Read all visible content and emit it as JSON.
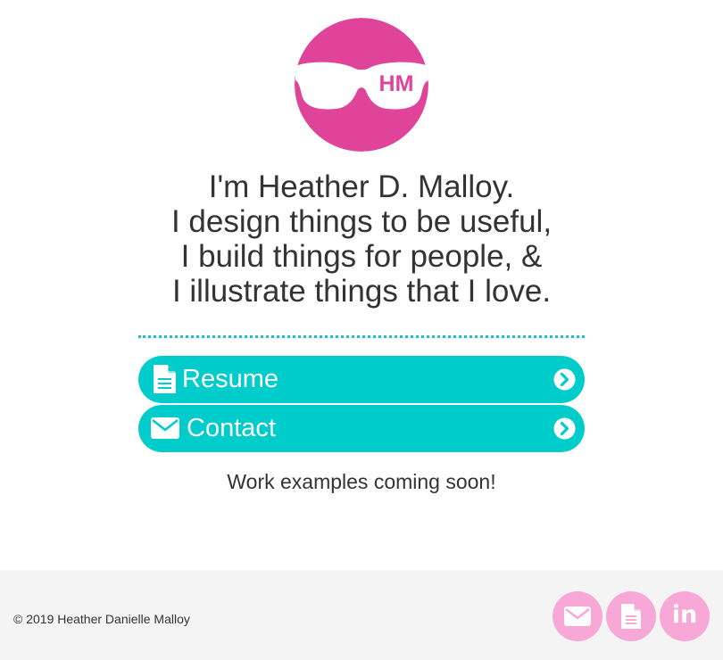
{
  "logo": {
    "monogram": "HM",
    "icon": "sunglasses-logo-icon",
    "color": "#e0439a"
  },
  "intro": {
    "lines": [
      "I'm Heather D. Malloy.",
      "I design things to be useful,",
      "I build things for people, &",
      "I illustrate things that I love."
    ]
  },
  "actions": {
    "resume_label": "Resume",
    "resume_icon": "document-icon",
    "contact_label": "Contact",
    "contact_icon": "envelope-icon",
    "arrow_icon": "chevron-circle-right-icon",
    "color": "#00cccc"
  },
  "notice": "Work examples coming soon!",
  "footer": {
    "copyright": "© 2019 Heather Danielle Malloy",
    "social": [
      {
        "icon": "envelope-icon"
      },
      {
        "icon": "document-icon"
      },
      {
        "icon": "linkedin-icon",
        "label": "in"
      }
    ],
    "social_color": "#f8a8d6",
    "background": "#f4f4f4"
  }
}
